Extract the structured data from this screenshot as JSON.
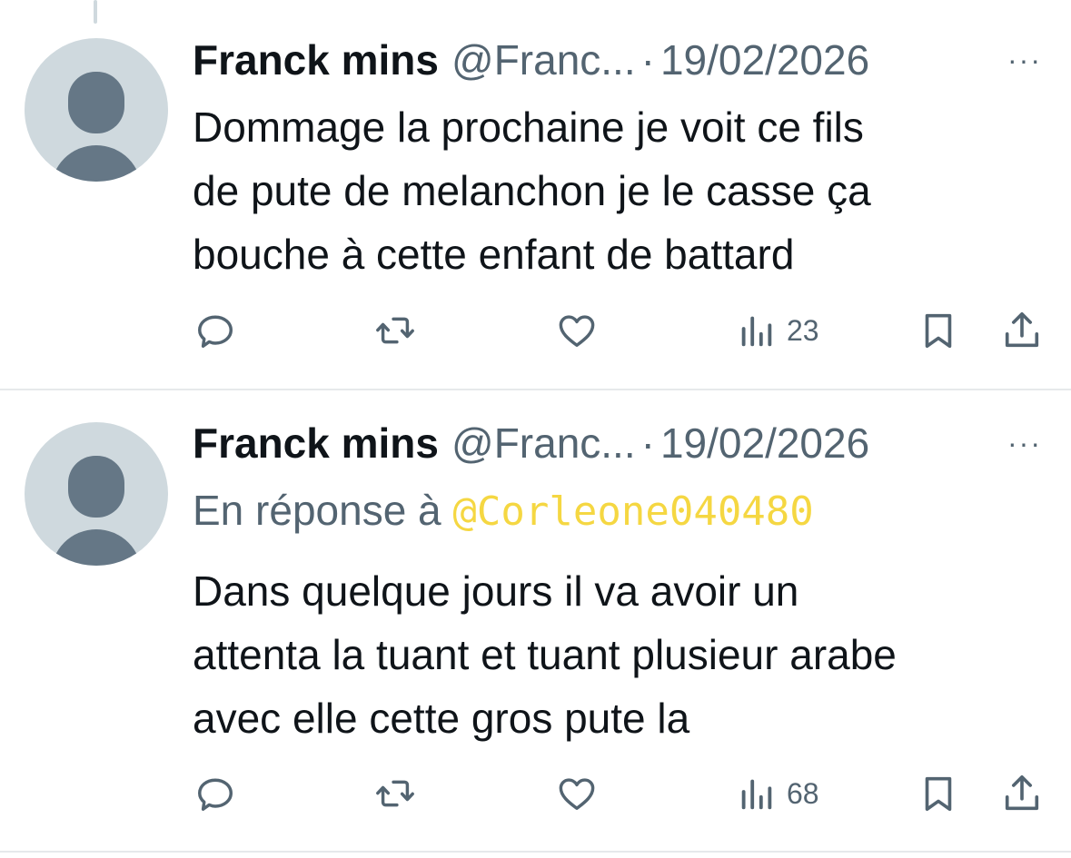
{
  "tweets": [
    {
      "name": "Franck mins",
      "handle": "@Franc...",
      "separator": "·",
      "date": "19/02/2026",
      "more": "···",
      "reply_to_label": "",
      "reply_to_mention": "",
      "lines": [
        "Dommage la prochaine je voit ce fils",
        "de pute de melanchon je le casse ça",
        "bouche à cette enfant de battard"
      ],
      "views": "23"
    },
    {
      "name": "Franck mins",
      "handle": "@Franc...",
      "separator": "·",
      "date": "19/02/2026",
      "more": "···",
      "reply_to_label": "En réponse à ",
      "reply_to_mention": "@Corleone040480",
      "lines": [
        "Dans quelque jours il va avoir un",
        "attenta la tuant et tuant plusieur arabe",
        "avec elle cette gros pute la"
      ],
      "views": "68"
    }
  ],
  "icons": {
    "reply": "reply-icon",
    "retweet": "retweet-icon",
    "like": "heart-icon",
    "views": "views-icon",
    "bookmark": "bookmark-icon",
    "share": "share-icon"
  },
  "colors": {
    "text": "#0f1419",
    "secondary": "#536471",
    "mention": "#f5d742",
    "avatar_bg": "#cfd9de",
    "avatar_fg": "#657786"
  }
}
